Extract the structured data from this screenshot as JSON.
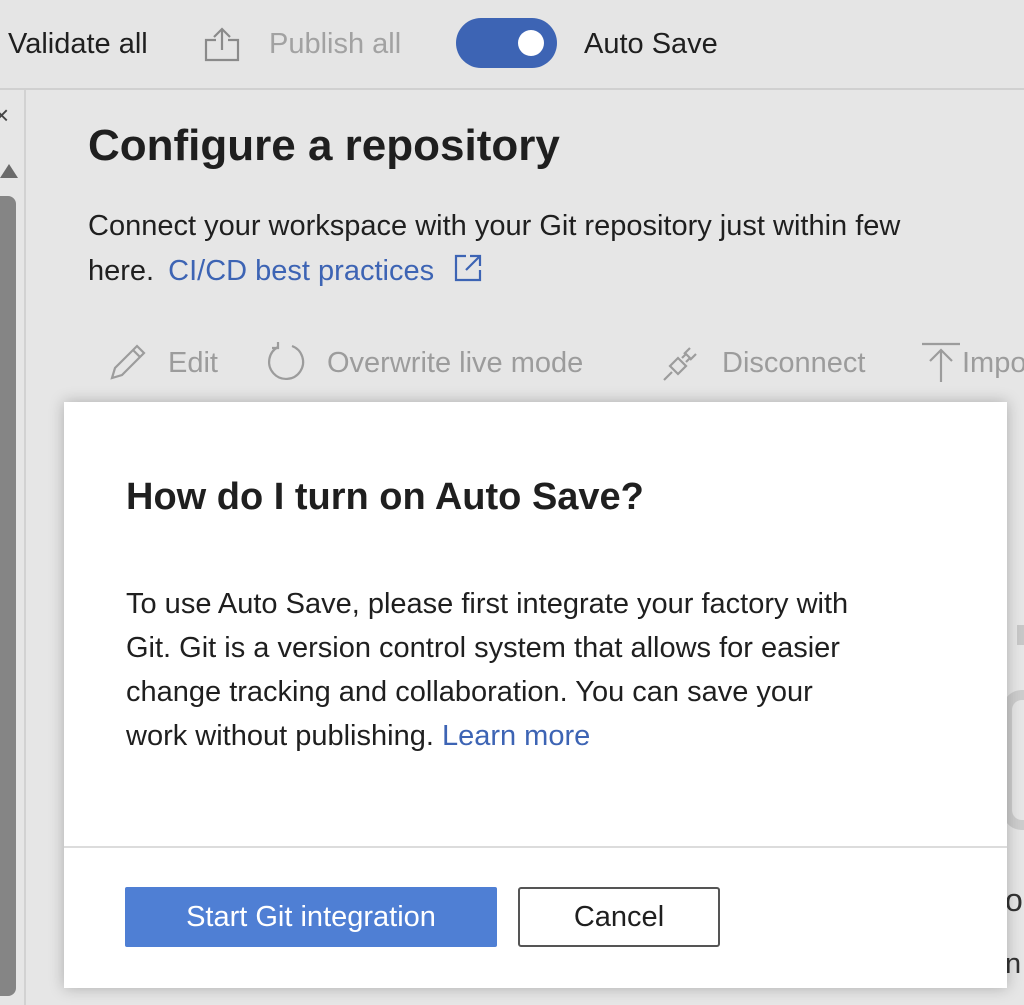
{
  "toolbar": {
    "validate_label": "Validate all",
    "publish_label": "Publish all",
    "autosave_label": "Auto Save",
    "autosave_on": true,
    "publish_icon": "upload-icon"
  },
  "left_rail": {
    "close_glyph": "×"
  },
  "main": {
    "title": "Configure a repository",
    "description_line1": "Connect your workspace with your Git repository just within few",
    "description_line2_prefix": "here.",
    "link_label": "CI/CD best practices",
    "link_icon": "external-link-icon",
    "actions": [
      {
        "label": "Edit",
        "icon": "pencil-icon"
      },
      {
        "label": "Overwrite live mode",
        "icon": "refresh-icon"
      },
      {
        "label": "Disconnect",
        "icon": "plug-icon"
      },
      {
        "label": "Impo",
        "icon": "upload-icon"
      }
    ]
  },
  "peek": {
    "char1": "o",
    "char2": "n"
  },
  "modal": {
    "title": "How do I turn on Auto Save?",
    "body_lines": [
      "To use Auto Save, please first integrate your factory with",
      "Git. Git is a version control system that allows for easier",
      "change tracking and collaboration. You can save your"
    ],
    "body_last_prefix": "work without publishing.",
    "learn_more_label": "Learn more",
    "primary_button": "Start Git integration",
    "secondary_button": "Cancel"
  },
  "colors": {
    "accent": "#3d64b4",
    "primary_button": "#4f7fd4",
    "disabled_text": "#9c9c9c"
  }
}
